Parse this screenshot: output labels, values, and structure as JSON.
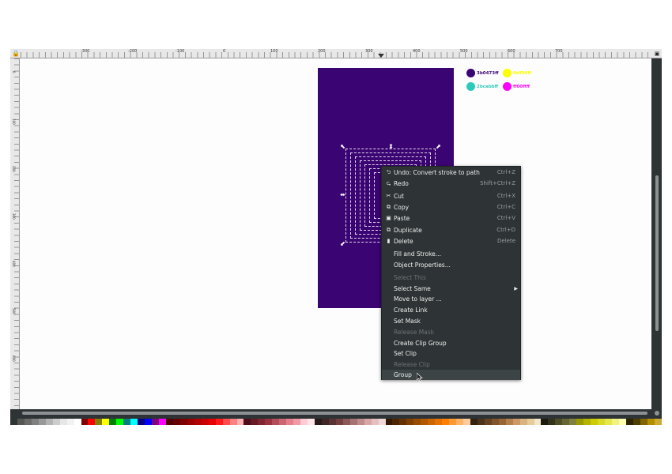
{
  "ruler": {
    "labels": [
      "-300",
      "-200",
      "-100",
      "0",
      "100",
      "200",
      "300",
      "400",
      "500",
      "600",
      "700"
    ],
    "vlabels": [
      "0",
      "100",
      "200",
      "300",
      "400",
      "500",
      "600"
    ]
  },
  "colors": {
    "purple": "#3b0473",
    "yellow": "#fbff00",
    "teal": "#2bcabb",
    "magenta": "#ff00ff"
  },
  "swatches": [
    {
      "label": "3b0473ff",
      "color": "#3b0473"
    },
    {
      "label": "fbff00ff",
      "color": "#fbff00"
    },
    {
      "label": "2bcabbff",
      "color": "#2bcabb"
    },
    {
      "label": "ff00ffff",
      "color": "#ff00ff"
    }
  ],
  "context_menu": {
    "items": [
      {
        "icon": "undo-icon",
        "glyph": "⮌",
        "label": "Undo: Convert stroke to path",
        "shortcut": "Ctrl+Z"
      },
      {
        "icon": "redo-icon",
        "glyph": "⮎",
        "label": "Redo",
        "shortcut": "Shift+Ctrl+Z"
      },
      {
        "icon": "cut-icon",
        "glyph": "✂",
        "label": "Cut",
        "shortcut": "Ctrl+X"
      },
      {
        "icon": "copy-icon",
        "glyph": "⧉",
        "label": "Copy",
        "shortcut": "Ctrl+C"
      },
      {
        "icon": "paste-icon",
        "glyph": "▣",
        "label": "Paste",
        "shortcut": "Ctrl+V"
      },
      {
        "icon": "duplicate-icon",
        "glyph": "⧉",
        "label": "Duplicate",
        "shortcut": "Ctrl+D"
      },
      {
        "icon": "delete-icon",
        "glyph": "▮",
        "label": "Delete",
        "shortcut": "Delete"
      },
      {
        "label": "Fill and Stroke..."
      },
      {
        "label": "Object Properties..."
      },
      {
        "label": "Select This",
        "disabled": true
      },
      {
        "label": "Select Same",
        "submenu": true
      },
      {
        "label": "Move to layer ..."
      },
      {
        "label": "Create Link"
      },
      {
        "label": "Set Mask"
      },
      {
        "label": "Release Mask",
        "disabled": true
      },
      {
        "label": "Create Clip Group"
      },
      {
        "label": "Set Clip"
      },
      {
        "label": "Release Clip",
        "disabled": true
      },
      {
        "label": "Group",
        "highlighted": true
      }
    ]
  },
  "palette": [
    "#2e3436",
    "#555753",
    "#6b6b6b",
    "#808080",
    "#999999",
    "#b3b3b3",
    "#cccccc",
    "#e6e6e6",
    "#f2f2f2",
    "#ffffff",
    "#800000",
    "#ff0000",
    "#808000",
    "#ffff00",
    "#008000",
    "#00ff00",
    "#008080",
    "#00ffff",
    "#000080",
    "#0000ff",
    "#800080",
    "#ff00ff",
    "#4d0000",
    "#660000",
    "#800000",
    "#990000",
    "#b30000",
    "#cc0000",
    "#e60000",
    "#ff1a1a",
    "#ff4d4d",
    "#ff8080",
    "#ffb3b3",
    "#4d0d1a",
    "#661a26",
    "#802633",
    "#993340",
    "#b34d59",
    "#cc6673",
    "#e6808c",
    "#f299a6",
    "#ffccd5",
    "#ffe6ea",
    "#261a1a",
    "#402626",
    "#593333",
    "#734040",
    "#8c5959",
    "#a67373",
    "#bf8c8c",
    "#d9a6a6",
    "#e6c0c0",
    "#f2d9d9",
    "#331a00",
    "#4d2600",
    "#663300",
    "#804000",
    "#994d00",
    "#b35900",
    "#cc6600",
    "#e67300",
    "#ff8000",
    "#ff9933",
    "#ffb366",
    "#ffcc99",
    "#332211",
    "#4d331a",
    "#664422",
    "#80552b",
    "#996633",
    "#b3804d",
    "#cc9966",
    "#d9b380",
    "#e6cc99",
    "#f2e6cc",
    "#1a1a0d",
    "#33331a",
    "#4d4d26",
    "#666633",
    "#808040",
    "#999900",
    "#b3b300",
    "#cccc00",
    "#d9d926",
    "#e6e64d",
    "#f2f280",
    "#ffffb3",
    "#2b2200",
    "#4d3d00",
    "#806600",
    "#b38f00",
    "#ccaa33"
  ]
}
